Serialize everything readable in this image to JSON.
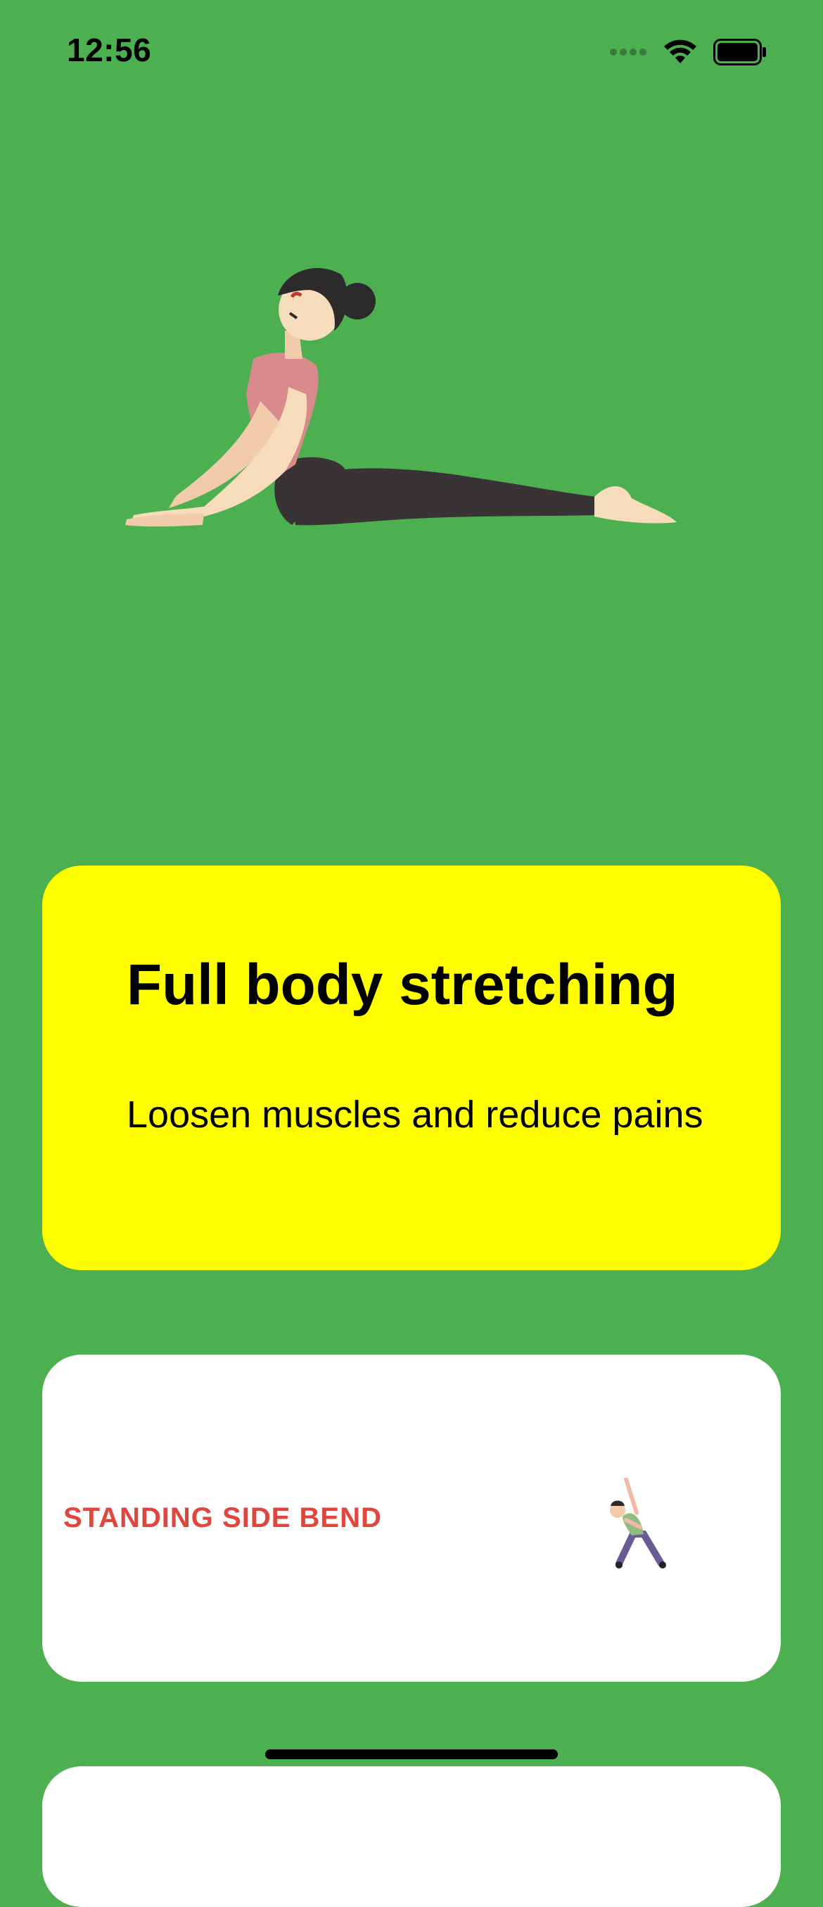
{
  "status_bar": {
    "time": "12:56",
    "icons": [
      "signal-icon",
      "wifi-icon",
      "battery-icon"
    ]
  },
  "hero": {
    "illustration": "cobra-pose-illustration"
  },
  "feature_card": {
    "title": "Full body stretching",
    "subtitle": "Loosen muscles and reduce pains",
    "background": "#ffff00"
  },
  "exercises": [
    {
      "label": "STANDING SIDE BEND",
      "thumbnail": "side-bend-illustration"
    }
  ],
  "colors": {
    "background": "#4caf50",
    "accent_text": "#e0463c",
    "card": "#ffffff"
  }
}
